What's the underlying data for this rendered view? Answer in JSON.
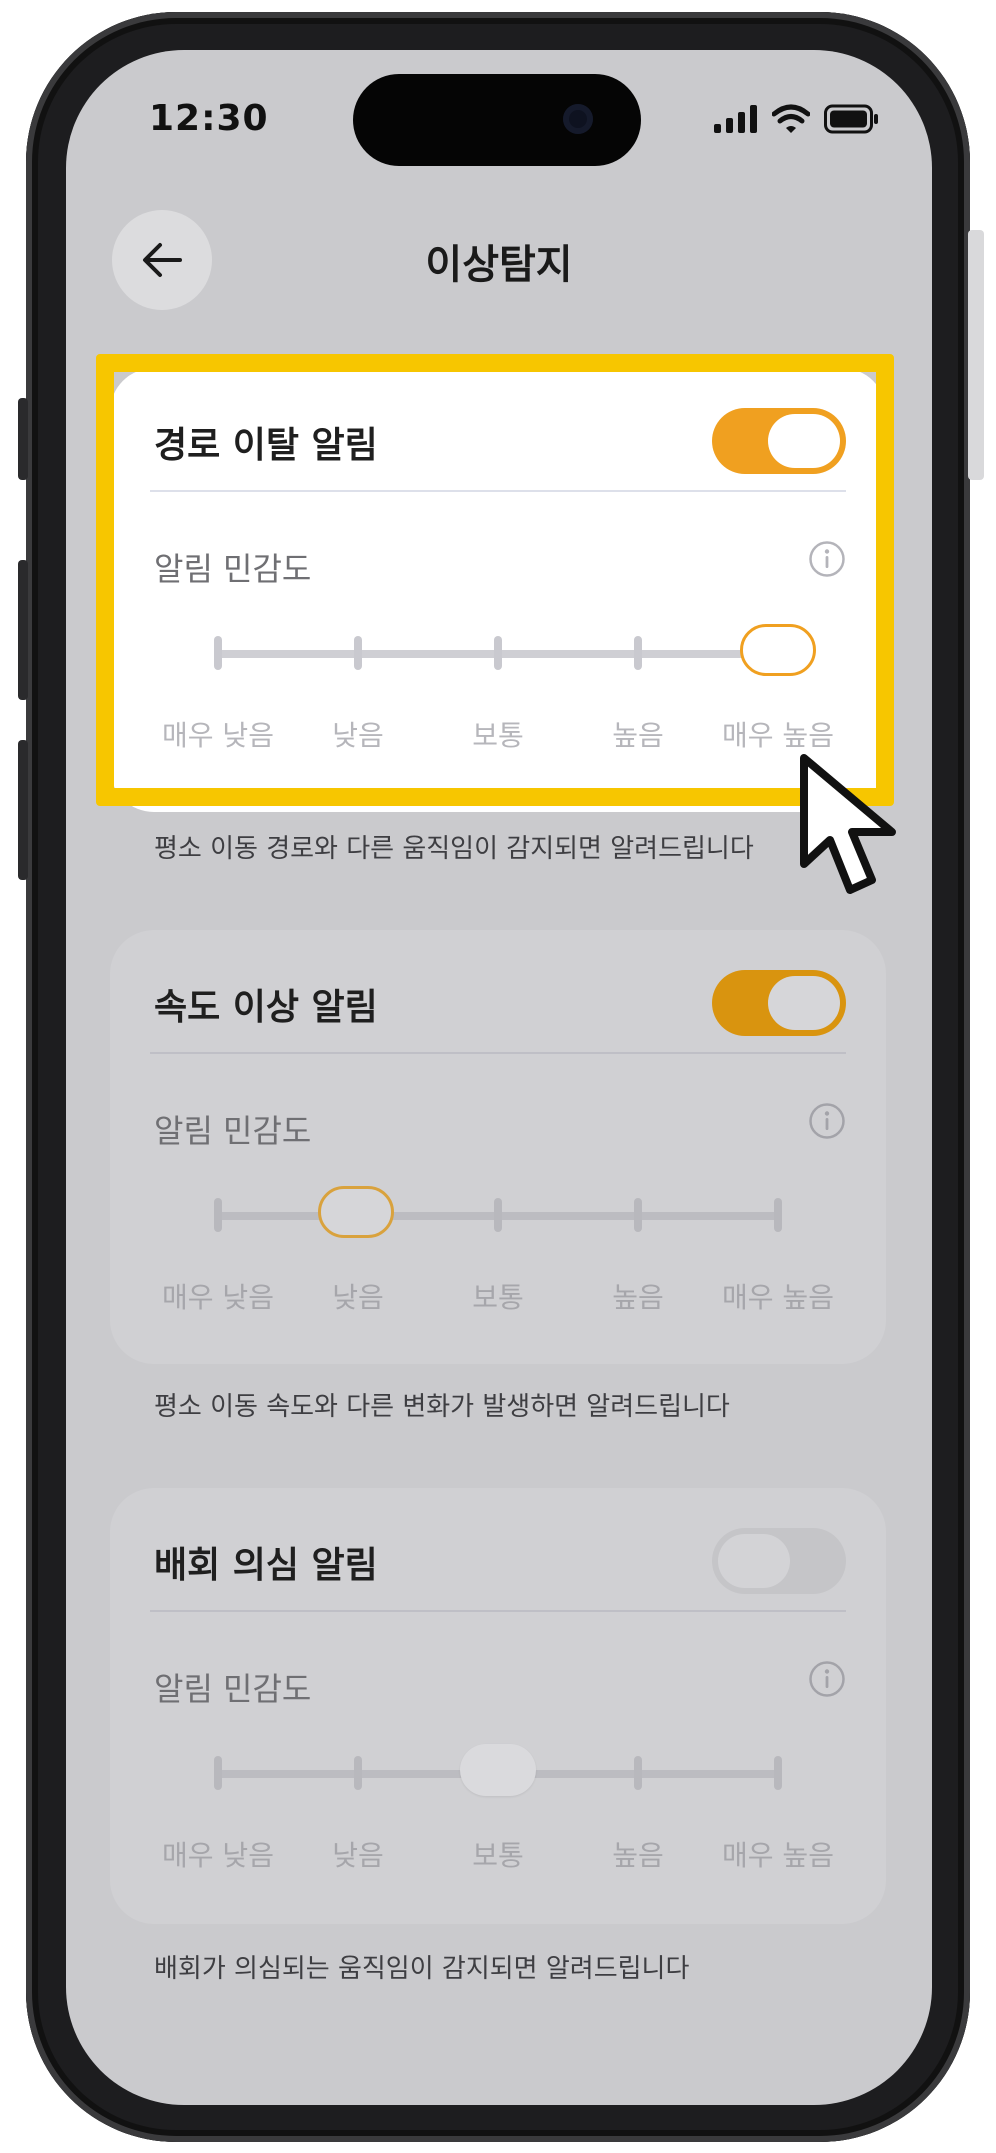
{
  "status_bar": {
    "time": "12:30"
  },
  "header": {
    "title": "이상탐지",
    "back_icon": "arrow-left-icon"
  },
  "sections": [
    {
      "title": "경로 이탈 알림",
      "enabled": true,
      "sensitivity_label": "알림 민감도",
      "steps": [
        "매우 낮음",
        "낮음",
        "보통",
        "높음",
        "매우 높음"
      ],
      "selected_step": 4,
      "description": "평소 이동 경로와 다른 움직임이 감지되면 알려드립니다"
    },
    {
      "title": "속도 이상 알림",
      "enabled": true,
      "sensitivity_label": "알림 민감도",
      "steps": [
        "매우 낮음",
        "낮음",
        "보통",
        "높음",
        "매우 높음"
      ],
      "selected_step": 1,
      "description": "평소 이동 속도와 다른 변화가 발생하면 알려드립니다"
    },
    {
      "title": "배회 의심 알림",
      "enabled": false,
      "sensitivity_label": "알림 민감도",
      "steps": [
        "매우 낮음",
        "낮음",
        "보통",
        "높음",
        "매우 높음"
      ],
      "selected_step": 2,
      "description": "배회가 의심되는 움직임이 감지되면 알려드립니다"
    }
  ],
  "colors": {
    "accent": "#f0a020",
    "highlight": "#f7c600",
    "screen_bg": "#cacacd"
  }
}
